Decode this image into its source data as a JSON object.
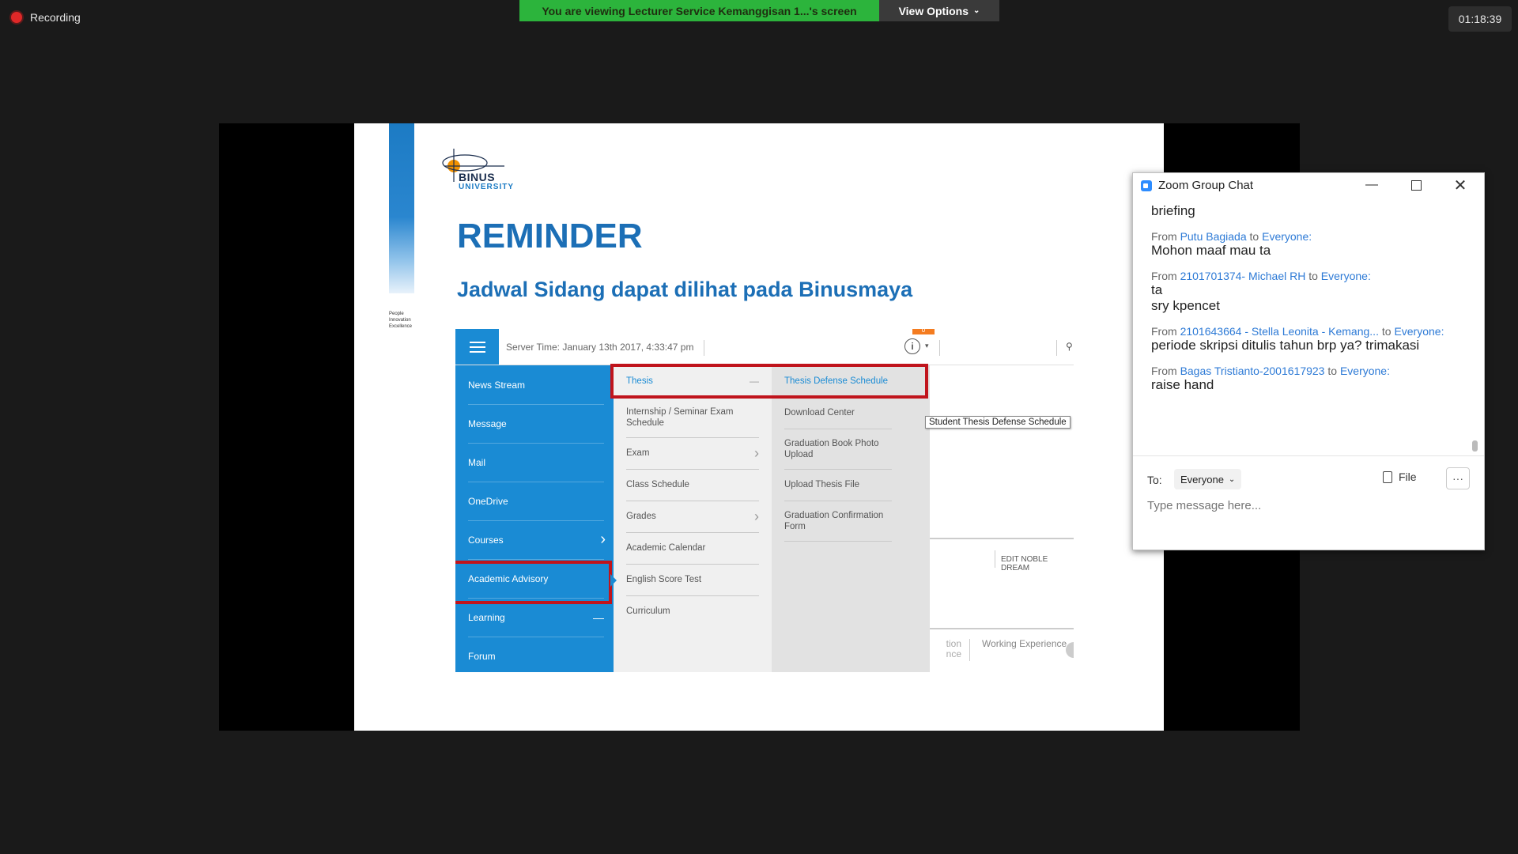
{
  "meeting": {
    "recording_label": "Recording",
    "viewing_banner": "You are viewing Lecturer Service Kemanggisan 1...'s screen",
    "view_options_label": "View Options",
    "elapsed_time": "01:18:39"
  },
  "slide": {
    "logo_text": "BINUS",
    "logo_subtext": "UNIVERSITY",
    "tagline": [
      "People",
      "Innovation",
      "Excellence"
    ],
    "title": "REMINDER",
    "subtitle": "Jadwal Sidang dapat dilihat pada Binusmaya",
    "embedded": {
      "server_time": "Server Time: January 13th 2017, 4:33:47 pm",
      "notification_count": "0",
      "nav_items": [
        "News Stream",
        "Message",
        "Mail",
        "OneDrive",
        "Courses",
        "Academic Advisory",
        "Learning",
        "Forum"
      ],
      "learning_items": [
        "Thesis",
        "Internship / Seminar Exam Schedule",
        "Exam",
        "Class Schedule",
        "Grades",
        "Academic Calendar",
        "English Score Test",
        "Curriculum"
      ],
      "thesis_items": [
        "Thesis Defense Schedule",
        "Download Center",
        "Graduation Book Photo Upload",
        "Upload Thesis File",
        "Graduation Confirmation Form"
      ],
      "tooltip": "Student Thesis Defense Schedule",
      "edit_label": "EDIT NOBLE DREAM",
      "tab_partial": "tion nce",
      "tab_working": "Working Experience",
      "highlight_color": "#c0141c"
    }
  },
  "chat": {
    "title": "Zoom Group Chat",
    "messages": [
      {
        "from": "",
        "to": "",
        "text": [
          "briefing"
        ]
      },
      {
        "from": "Putu Bagiada",
        "to": "Everyone:",
        "text": [
          "Mohon maaf mau ta"
        ]
      },
      {
        "from": "2101701374- Michael RH",
        "to": "Everyone:",
        "text": [
          "ta",
          "sry kpencet"
        ]
      },
      {
        "from": "2101643664 - Stella Leonita - Kemang...",
        "to": "Everyone:",
        "text": [
          "periode skripsi ditulis tahun brp ya? trimakasi"
        ]
      },
      {
        "from": "Bagas Tristianto-2001617923",
        "to": "Everyone:",
        "text": [
          "raise hand"
        ]
      }
    ],
    "from_word": "From",
    "to_word": "to",
    "to_label": "To:",
    "recipient": "Everyone",
    "file_label": "File",
    "more_label": "···",
    "input_placeholder": "Type message here..."
  }
}
